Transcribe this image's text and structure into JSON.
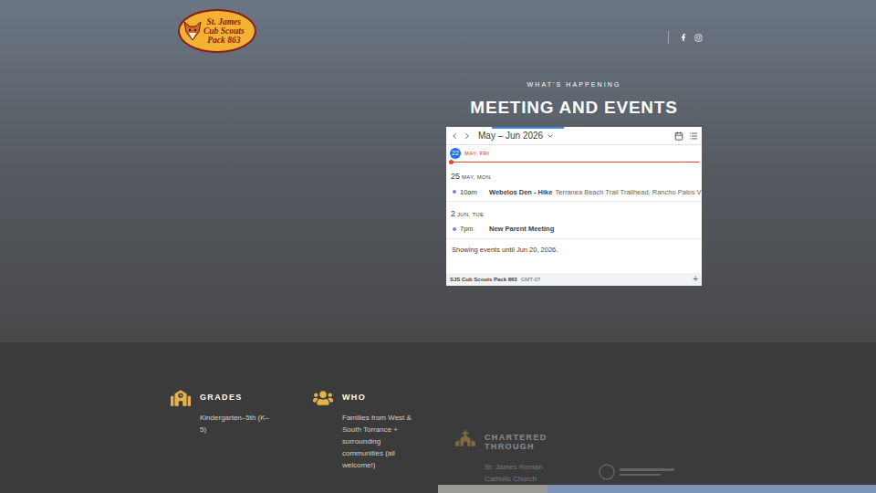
{
  "logo": {
    "lines": [
      "St. James",
      "Cub Scouts",
      "Pack 863"
    ]
  },
  "hero": {
    "eyebrow": "WHAT'S HAPPENING",
    "title": "MEETING AND EVENTS"
  },
  "calendar": {
    "range": "May – Jun 2026",
    "today": {
      "day": "22",
      "label": "MAY, FRI"
    },
    "days": [
      {
        "day": "25",
        "label": "MAY, MON",
        "events": [
          {
            "time": "10am",
            "title": "Webelos Den - Hike",
            "location": "Terranea Beach Trail Trailhead, Rancho Palos V…",
            "color": "#8e7cc3"
          }
        ]
      },
      {
        "day": "2",
        "label": "JUN, TUE",
        "events": [
          {
            "time": "7pm",
            "title": "New Parent Meeting",
            "color": "#8e7cc3"
          }
        ]
      }
    ],
    "notice": "Showing events until Jun 20, 2026.",
    "footer": {
      "calendar_name": "SJS Cub Scouts Pack 863",
      "timezone": "GMT-07",
      "add": "+"
    }
  },
  "facts": [
    {
      "title": "GRADES",
      "text": "Kindergarten–5th (K–5)",
      "faded": false
    },
    {
      "title": "WHO",
      "text": "Families from West & South Torrance + surrounding communities (all welcome!)",
      "faded": false
    },
    {
      "title": "CHARTERED THROUGH",
      "text": "St. James Roman Catholic Church",
      "faded": true
    }
  ]
}
